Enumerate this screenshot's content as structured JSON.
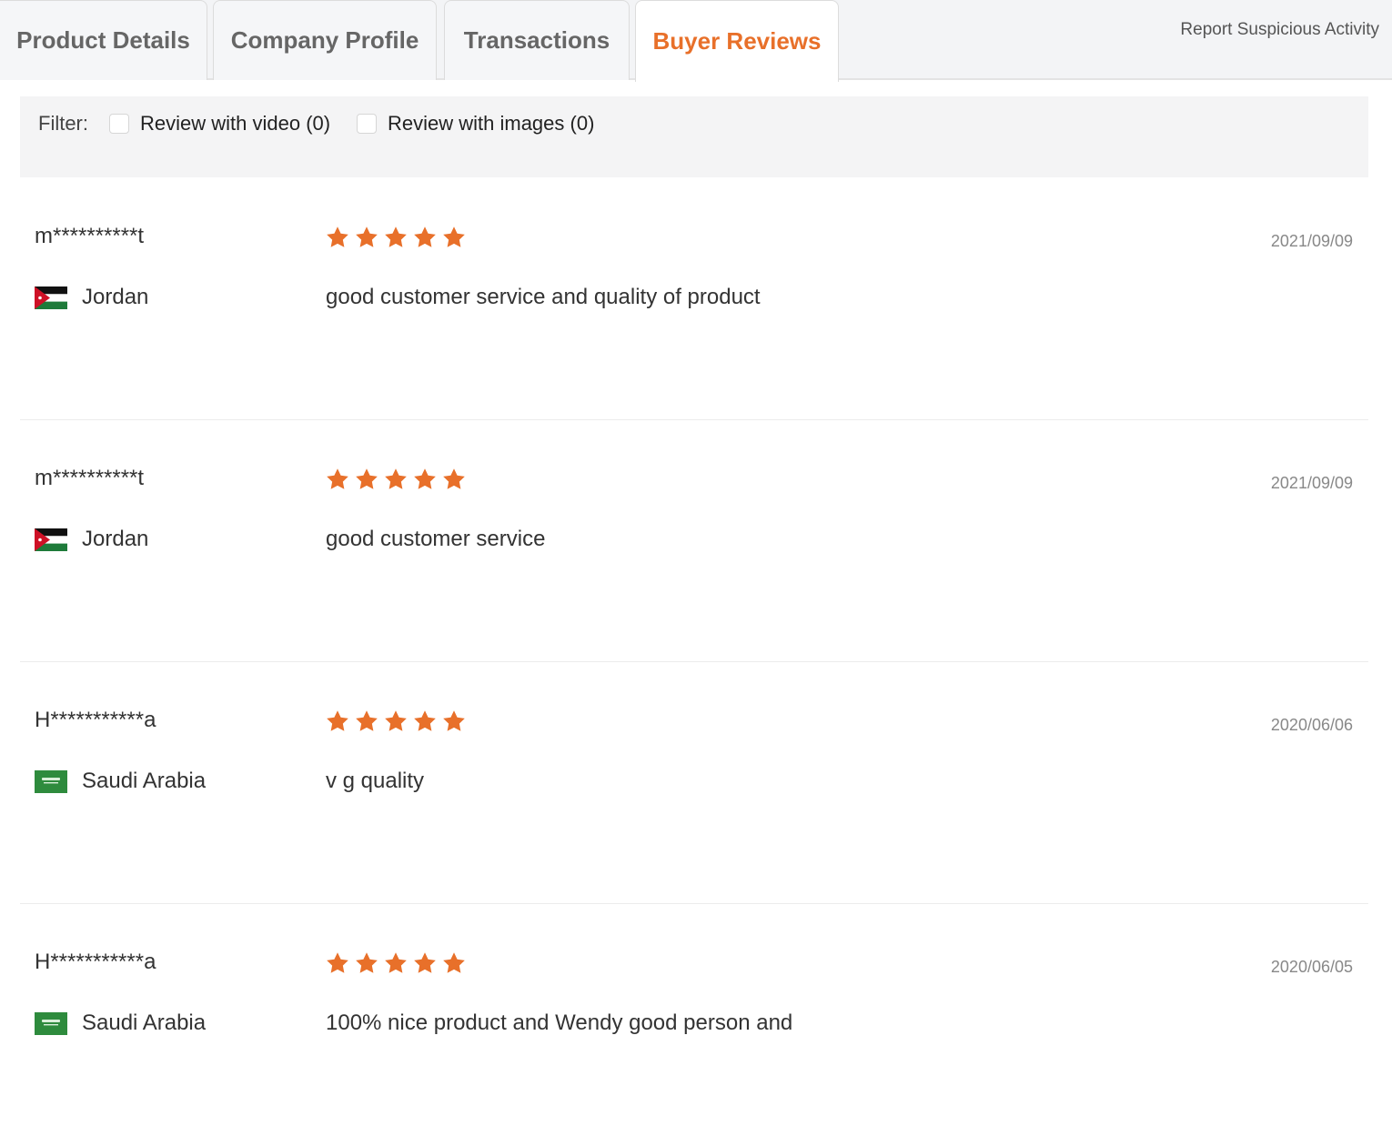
{
  "tabs": {
    "product_details": "Product Details",
    "company_profile": "Company Profile",
    "transactions": "Transactions",
    "buyer_reviews": "Buyer Reviews",
    "active": "Buyer Reviews"
  },
  "header": {
    "report_link": "Report Suspicious Activity"
  },
  "filter": {
    "label": "Filter:",
    "video_option": "Review with video (0)",
    "images_option": "Review with images (0)"
  },
  "colors": {
    "accent": "#e8702a",
    "star": "#e8702a"
  },
  "reviews": [
    {
      "reviewer": "m**********t",
      "country": "Jordan",
      "flag_icon": "jordan-flag-icon",
      "rating": 5,
      "text": "good customer service and quality of product",
      "date": "2021/09/09"
    },
    {
      "reviewer": "m**********t",
      "country": "Jordan",
      "flag_icon": "jordan-flag-icon",
      "rating": 5,
      "text": "good customer service",
      "date": "2021/09/09"
    },
    {
      "reviewer": "H***********a",
      "country": "Saudi Arabia",
      "flag_icon": "saudi-arabia-flag-icon",
      "rating": 5,
      "text": "v g quality",
      "date": "2020/06/06"
    },
    {
      "reviewer": "H***********a",
      "country": "Saudi Arabia",
      "flag_icon": "saudi-arabia-flag-icon",
      "rating": 5,
      "text": "100% nice product and Wendy good person and",
      "date": "2020/06/05"
    }
  ]
}
